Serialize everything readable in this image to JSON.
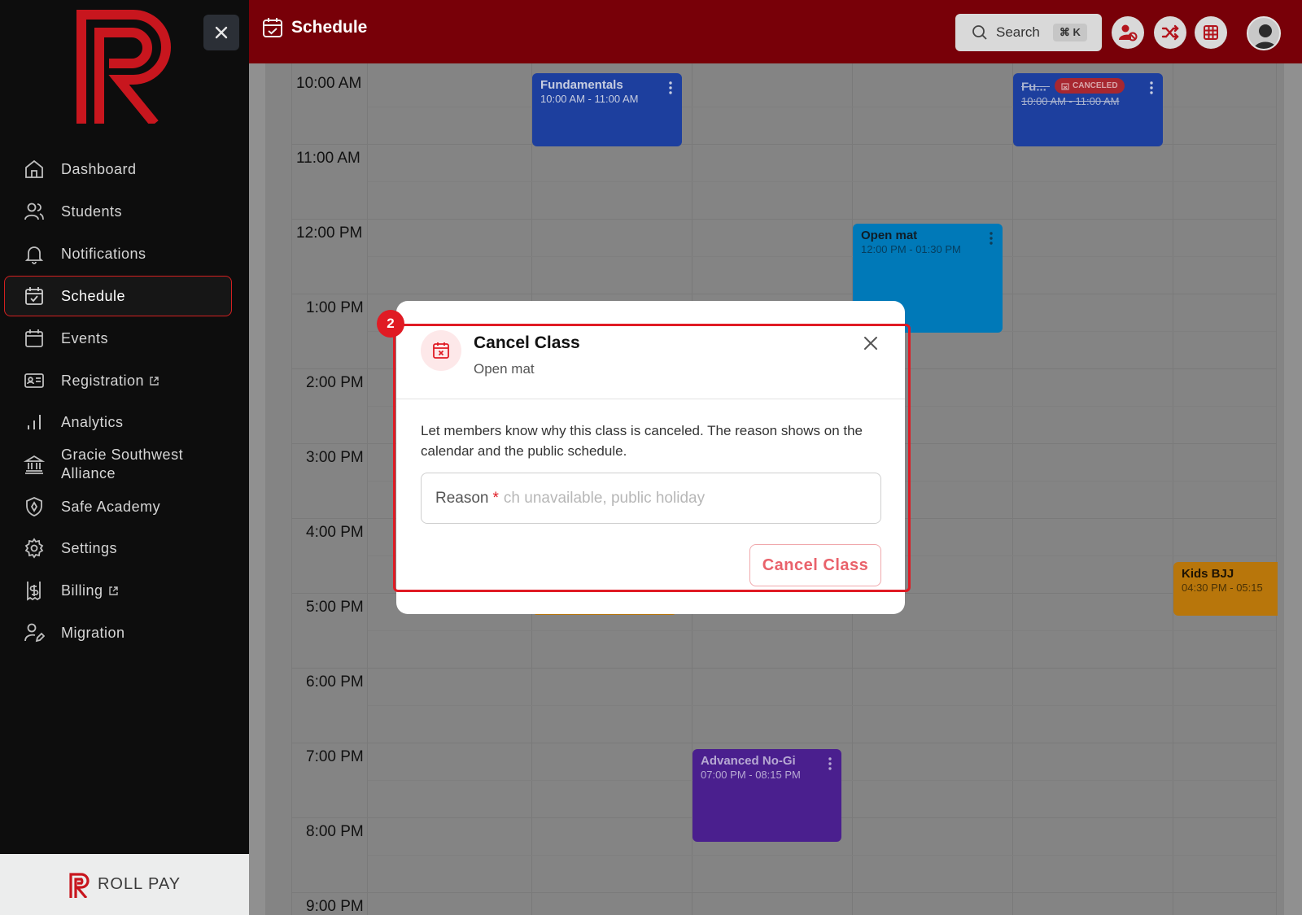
{
  "sidebar": {
    "items": [
      {
        "label": "Dashboard",
        "icon": "home-icon"
      },
      {
        "label": "Students",
        "icon": "users-icon"
      },
      {
        "label": "Notifications",
        "icon": "bell-icon"
      },
      {
        "label": "Schedule",
        "icon": "calendar-check-icon",
        "active": true
      },
      {
        "label": "Events",
        "icon": "calendar-icon"
      },
      {
        "label": "Registration",
        "icon": "id-card-icon",
        "external": true
      },
      {
        "label": "Analytics",
        "icon": "bar-chart-icon"
      },
      {
        "label": "Gracie Southwest Alliance",
        "icon": "institution-icon"
      },
      {
        "label": "Safe Academy",
        "icon": "shield-icon"
      },
      {
        "label": "Settings",
        "icon": "gear-icon"
      },
      {
        "label": "Billing",
        "icon": "dollar-icon",
        "external": true
      },
      {
        "label": "Migration",
        "icon": "user-edit-icon"
      }
    ],
    "footer_brand": "ROLL PAY"
  },
  "header": {
    "title": "Schedule",
    "search_label": "Search",
    "search_shortcut": "⌘ K"
  },
  "calendar": {
    "hours": [
      "10:00 AM",
      "11:00 AM",
      "12:00 PM",
      "1:00 PM",
      "2:00 PM",
      "3:00 PM",
      "4:00 PM",
      "5:00 PM",
      "6:00 PM",
      "7:00 PM",
      "8:00 PM",
      "9:00 PM"
    ],
    "events": {
      "fundamentals": {
        "title": "Fundamentals",
        "time": "10:00 AM - 11:00 AM"
      },
      "fundamentals_canceled": {
        "title": "Fu...",
        "badge": "CANCELED",
        "time": "10:00 AM - 11:00 AM"
      },
      "open_mat": {
        "title": "Open mat",
        "time": "12:00 PM - 01:30 PM"
      },
      "kids_bjj": {
        "title": "Kids BJJ",
        "time": "04:30 PM - 05:15"
      },
      "advanced_nogi": {
        "title": "Advanced No-Gi",
        "time": "07:00 PM - 08:15 PM"
      }
    }
  },
  "modal": {
    "step": "2",
    "title": "Cancel Class",
    "subtitle": "Open mat",
    "description": "Let members know why this class is canceled. The reason shows on the calendar and the public schedule.",
    "reason_label": "Reason",
    "reason_required": "*",
    "reason_placeholder": "ch unavailable, public holiday",
    "submit_label": "Cancel Class"
  },
  "colors": {
    "brand_red": "#780008",
    "accent_red": "#e01b24",
    "event_blue": "#1d3f9e",
    "event_cyan": "#0079b8",
    "event_orange": "#b8760b",
    "event_purple": "#4a1f8e"
  }
}
